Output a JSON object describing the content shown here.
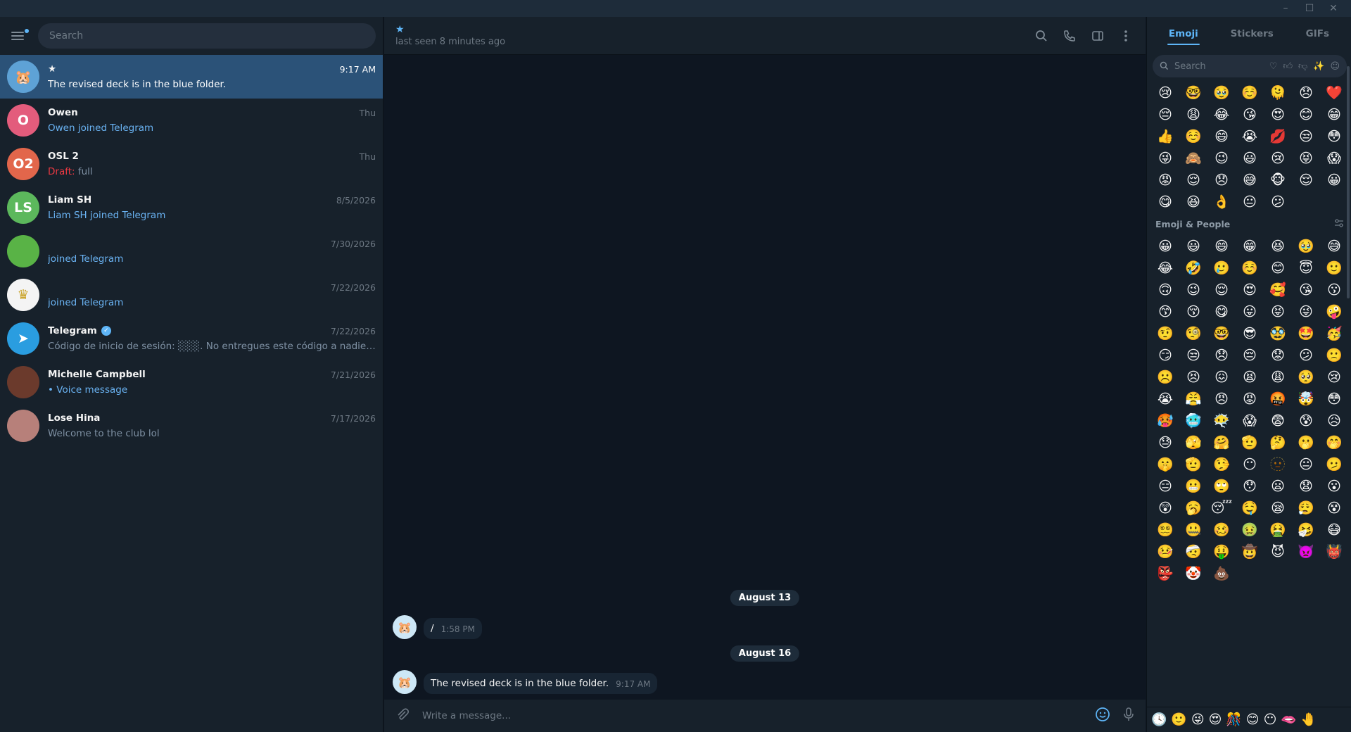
{
  "window": {
    "controls": [
      "–",
      "☐",
      "✕"
    ]
  },
  "sidebar": {
    "search_placeholder": "Search",
    "chats": [
      {
        "name": "★",
        "time": "9:17 AM",
        "preview": "The revised deck is in the blue folder.",
        "avatar_text": "🐹",
        "avatar_color": "#5ea2d6",
        "active": true,
        "preview_style": "normal"
      },
      {
        "name": "Owen",
        "time": "Thu",
        "preview": "Owen joined Telegram",
        "avatar_text": "O",
        "avatar_color": "#e35c7c",
        "preview_style": "blue"
      },
      {
        "name": "OSL 2",
        "time": "Thu",
        "draft_label": "Draft:",
        "preview": " full",
        "avatar_text": "O2",
        "avatar_color": "#e2664b",
        "preview_style": "draft"
      },
      {
        "name": "Liam SH",
        "time": "8/5/2026",
        "preview": "Liam SH joined Telegram",
        "avatar_text": "LS",
        "avatar_color": "#5cb85c",
        "preview_style": "blue"
      },
      {
        "name": "",
        "time": "7/30/2026",
        "preview": " joined Telegram",
        "avatar_text": "",
        "avatar_color": "#59b346",
        "preview_style": "blue"
      },
      {
        "name": "",
        "time": "7/22/2026",
        "preview": " joined Telegram",
        "avatar_text": "♛",
        "avatar_color": "#f4f4f4",
        "preview_style": "blue"
      },
      {
        "name": "Telegram",
        "time": "7/22/2026",
        "preview": "Código de inicio de sesión: ░░░. No entregues este código a nadie, ¡aunque ...",
        "avatar_text": "➤",
        "avatar_color": "#2a9de0",
        "preview_style": "normal",
        "verified": true
      },
      {
        "name": "Michelle Campbell",
        "time": "7/21/2026",
        "preview": "• Voice message",
        "avatar_text": "",
        "avatar_color": "#6b3a2c",
        "preview_style": "blue"
      },
      {
        "name": "Lose Hina",
        "time": "7/17/2026",
        "preview": "Welcome to the club lol",
        "avatar_text": "",
        "avatar_color": "#b7807a",
        "preview_style": "normal"
      }
    ]
  },
  "chat": {
    "peer_name": "★",
    "peer_status": "last seen 8 minutes ago",
    "date1": "August 13",
    "msg1_text": "/",
    "msg1_time": "1:58 PM",
    "date2": "August 16",
    "msg2_text": "The revised deck is in the blue folder.",
    "msg2_time": "9:17 AM",
    "composer_placeholder": "Write a message..."
  },
  "emoji_panel": {
    "tabs": [
      "Emoji",
      "Stickers",
      "GIFs"
    ],
    "search_placeholder": "Search",
    "section_title": "Emoji & People",
    "recent": [
      "😢",
      "🤓",
      "🥹",
      "☺️",
      "🫠",
      "😞",
      "❤️",
      "😔",
      "😩",
      "😂",
      "😘",
      "😍",
      "😊",
      "😁",
      "👍",
      "☺️",
      "😄",
      "😭",
      "💋",
      "😒",
      "😳",
      "😜",
      "🙈",
      "😉",
      "😃",
      "😢",
      "😝",
      "😱",
      "😡",
      "😌",
      "😞",
      "😅",
      "🐵",
      "😌",
      "😀",
      "😋",
      "😆",
      "👌",
      "😐",
      "😕"
    ],
    "people": [
      "😀",
      "😃",
      "😄",
      "😁",
      "😆",
      "🥹",
      "😅",
      "😂",
      "🤣",
      "🥲",
      "☺️",
      "😊",
      "😇",
      "🙂",
      "🙃",
      "😉",
      "😌",
      "😍",
      "🥰",
      "😘",
      "😗",
      "😙",
      "😚",
      "😋",
      "😛",
      "😝",
      "😜",
      "🤪",
      "🤨",
      "🧐",
      "🤓",
      "😎",
      "🥸",
      "🤩",
      "🥳",
      "😏",
      "😒",
      "😞",
      "😔",
      "😟",
      "😕",
      "🙁",
      "☹️",
      "😣",
      "😖",
      "😫",
      "😩",
      "🥺",
      "😢",
      "😭",
      "😤",
      "😠",
      "😡",
      "🤬",
      "🤯",
      "😳",
      "🥵",
      "🥶",
      "😶‍🌫️",
      "😱",
      "😨",
      "😰",
      "😥",
      "😓",
      "🫣",
      "🤗",
      "🫡",
      "🤔",
      "🫢",
      "🤭",
      "🤫",
      "🫡",
      "🤥",
      "😶",
      "🫥",
      "😐",
      "🫤",
      "😑",
      "😬",
      "🙄",
      "😯",
      "😦",
      "😧",
      "😮",
      "😲",
      "🥱",
      "😴",
      "🤤",
      "😪",
      "😮‍💨",
      "😵",
      "😵‍💫",
      "🤐",
      "🥴",
      "🤢",
      "🤮",
      "🤧",
      "😷",
      "🤒",
      "🤕",
      "🤑",
      "🤠",
      "😈",
      "👿",
      "👹",
      "👺",
      "🤡",
      "💩"
    ],
    "bottom_icons": [
      "🕓",
      "🙂",
      "😜",
      "😍",
      "🎊",
      "😊",
      "😶",
      "🫦",
      "🤚"
    ]
  }
}
